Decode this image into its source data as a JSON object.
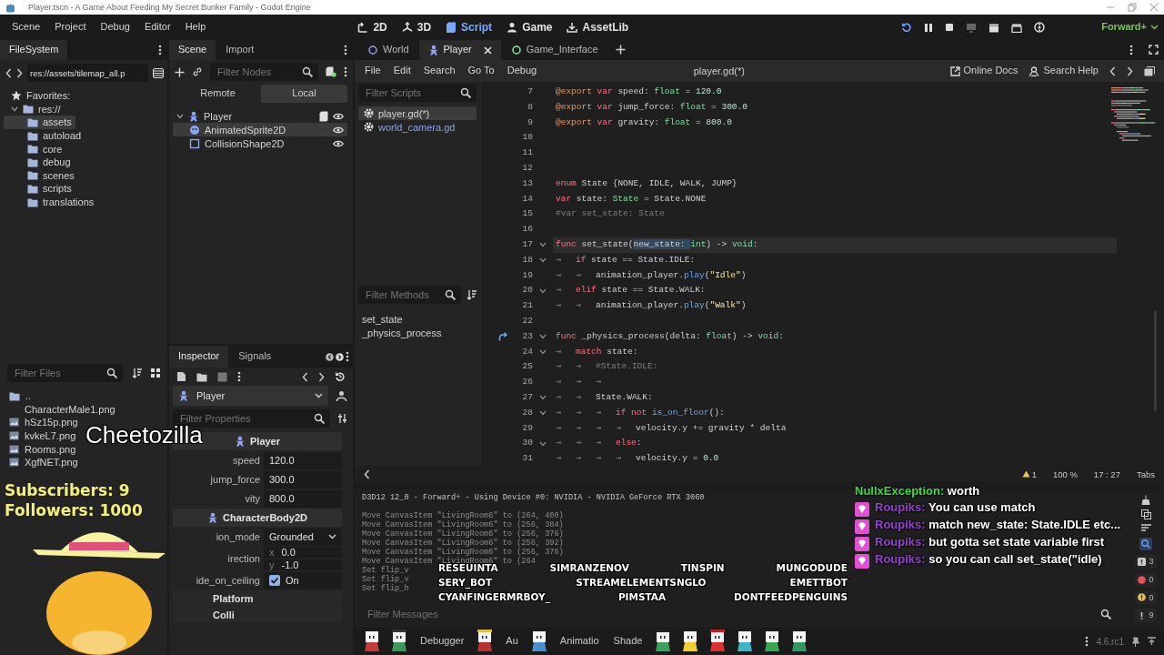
{
  "window": {
    "title": "Player.tscn - A Game About Feeding My Secret Bunker Family - Godot Engine"
  },
  "menu": [
    "Scene",
    "Project",
    "Debug",
    "Editor",
    "Help"
  ],
  "workspaces": [
    {
      "label": "2D",
      "kind": "flat",
      "selected": false
    },
    {
      "label": "3D",
      "kind": "spatial",
      "selected": false
    },
    {
      "label": "Script",
      "kind": "script",
      "selected": true
    },
    {
      "label": "Game",
      "kind": "game",
      "selected": false
    },
    {
      "label": "AssetLib",
      "kind": "assetlib",
      "selected": false
    }
  ],
  "renderer": "Forward+",
  "filesystem": {
    "tab": "FileSystem",
    "path": "res://assets/tilemap_all.p",
    "tree": [
      {
        "label": "Favorites:",
        "kind": "favorites",
        "selected": false
      },
      {
        "label": "res://",
        "kind": "folder",
        "selected": false,
        "expanded": true,
        "children": [
          {
            "label": "assets",
            "kind": "folder",
            "selected": true
          },
          {
            "label": "autoload",
            "kind": "folder",
            "selected": false
          },
          {
            "label": "core",
            "kind": "folder",
            "selected": false
          },
          {
            "label": "debug",
            "kind": "folder",
            "selected": false
          },
          {
            "label": "scenes",
            "kind": "folder",
            "selected": false
          },
          {
            "label": "scripts",
            "kind": "folder",
            "selected": false
          },
          {
            "label": "translations",
            "kind": "folder",
            "selected": false
          }
        ]
      }
    ],
    "filter": {
      "placeholder": "Filter Files"
    },
    "files": [
      {
        "label": "..",
        "kind": "folder"
      },
      {
        "label": "CharacterMale1.png",
        "kind": "blank"
      },
      {
        "label": "hSz15p.png",
        "kind": "image"
      },
      {
        "label": "kvkeL7.png",
        "kind": "image"
      },
      {
        "label": "Rooms.png",
        "kind": "image"
      },
      {
        "label": "XgfNET.png",
        "kind": "image"
      }
    ]
  },
  "scene": {
    "tabs": [
      {
        "label": "Scene",
        "selected": true
      },
      {
        "label": "Import",
        "selected": false
      }
    ],
    "filter": {
      "placeholder": "Filter Nodes"
    },
    "modes": [
      {
        "label": "Remote",
        "selected": false
      },
      {
        "label": "Local",
        "selected": true
      }
    ],
    "tree": [
      {
        "label": "Player",
        "kind": "character",
        "selected": false,
        "expanded": true,
        "script": true,
        "children": [
          {
            "label": "AnimatedSprite2D",
            "kind": "sprite",
            "selected": true,
            "script": false
          },
          {
            "label": "CollisionShape2D",
            "kind": "shape",
            "selected": false,
            "script": false
          }
        ]
      }
    ]
  },
  "inspector": {
    "tabs": [
      {
        "label": "Inspector",
        "selected": true
      },
      {
        "label": "Signals",
        "selected": false
      }
    ],
    "object": "Player",
    "filter": {
      "placeholder": "Filter Properties"
    },
    "rows": [
      {
        "kind": "section",
        "label": "Player"
      },
      {
        "kind": "number",
        "label": "speed",
        "value": "120.0"
      },
      {
        "kind": "number",
        "label": "jump_force",
        "value": "300.0"
      },
      {
        "kind": "number",
        "label": "vity",
        "value": "800.0"
      },
      {
        "kind": "section",
        "label": "CharacterBody2D"
      },
      {
        "kind": "select",
        "label": "ion_mode",
        "value": "Grounded"
      },
      {
        "kind": "vector",
        "label": "irection",
        "axes": [
          {
            "label": "x",
            "value": "0.0"
          },
          {
            "label": "y",
            "value": "-1.0"
          }
        ]
      },
      {
        "kind": "check",
        "label": "ide_on_ceiling",
        "checked": true,
        "value": "On"
      },
      {
        "kind": "group",
        "label": "Platform"
      },
      {
        "kind": "group",
        "label": "Colli"
      }
    ]
  },
  "script_editor": {
    "tabs": [
      {
        "label": "World",
        "kind": "node2d",
        "selected": false
      },
      {
        "label": "Player",
        "kind": "character",
        "selected": true
      },
      {
        "label": "Game_Interface",
        "kind": "control",
        "selected": false
      }
    ],
    "menu": [
      "File",
      "Edit",
      "Search",
      "Go To",
      "Debug"
    ],
    "file": "player.gd(*)",
    "links": [
      "Online Docs",
      "Search Help"
    ],
    "scripts": {
      "placeholder": "Filter Scripts",
      "items": [
        {
          "label": "player.gd(*)",
          "selected": true
        },
        {
          "label": "world_camera.gd",
          "selected": false
        }
      ]
    },
    "methods": {
      "placeholder": "Filter Methods",
      "items": [
        "set_state",
        "_physics_process"
      ]
    },
    "lines": [
      {
        "n": "7",
        "fold": false,
        "current": false,
        "override": false,
        "tokens": [
          {
            "kind": "annotation",
            "text": "@export "
          },
          {
            "kind": "keyword",
            "text": "var"
          },
          {
            "kind": "plain",
            "text": " speed: "
          },
          {
            "kind": "type",
            "text": "float"
          },
          {
            "kind": "plain",
            "text": " = "
          },
          {
            "kind": "number",
            "text": "120.0"
          }
        ]
      },
      {
        "n": "8",
        "fold": false,
        "current": false,
        "override": false,
        "tokens": [
          {
            "kind": "annotation",
            "text": "@export "
          },
          {
            "kind": "keyword",
            "text": "var"
          },
          {
            "kind": "plain",
            "text": " jump_force: "
          },
          {
            "kind": "type",
            "text": "float"
          },
          {
            "kind": "plain",
            "text": " = "
          },
          {
            "kind": "number",
            "text": "300.0"
          }
        ]
      },
      {
        "n": "9",
        "fold": false,
        "current": false,
        "override": false,
        "tokens": [
          {
            "kind": "annotation",
            "text": "@export "
          },
          {
            "kind": "keyword",
            "text": "var"
          },
          {
            "kind": "plain",
            "text": " gravity: "
          },
          {
            "kind": "type",
            "text": "float"
          },
          {
            "kind": "plain",
            "text": " = "
          },
          {
            "kind": "number",
            "text": "800.0"
          }
        ]
      },
      {
        "n": "10",
        "fold": false,
        "current": false,
        "override": false
      },
      {
        "n": "11",
        "fold": false,
        "current": false,
        "override": false
      },
      {
        "n": "12",
        "fold": false,
        "current": false,
        "override": false
      },
      {
        "n": "13",
        "fold": false,
        "current": false,
        "override": false,
        "tokens": [
          {
            "kind": "keyword",
            "text": "enum"
          },
          {
            "kind": "plain",
            "text": " State {NONE, IDLE, WALK, JUMP}"
          }
        ]
      },
      {
        "n": "14",
        "fold": false,
        "current": false,
        "override": false,
        "tokens": [
          {
            "kind": "keyword",
            "text": "var"
          },
          {
            "kind": "plain",
            "text": " state: "
          },
          {
            "kind": "type",
            "text": "State"
          },
          {
            "kind": "plain",
            "text": " = State.NONE"
          }
        ]
      },
      {
        "n": "15",
        "fold": false,
        "current": false,
        "override": false,
        "tokens": [
          {
            "kind": "comment",
            "text": "#var set_state: State"
          }
        ]
      },
      {
        "n": "16",
        "fold": false,
        "current": false,
        "override": false
      },
      {
        "n": "17",
        "fold": true,
        "current": true,
        "override": false,
        "tokens": [
          {
            "kind": "keyword",
            "text": "func"
          },
          {
            "kind": "plain",
            "text": " set_state("
          },
          {
            "kind": "selection",
            "text": "new_state: "
          },
          {
            "kind": "type",
            "text": "int"
          },
          {
            "kind": "plain",
            "text": ") -> "
          },
          {
            "kind": "type",
            "text": "void"
          },
          {
            "kind": "plain",
            "text": ":"
          }
        ]
      },
      {
        "n": "18",
        "fold": true,
        "current": false,
        "override": false,
        "tokens": [
          {
            "kind": "tab",
            "text": "⇥"
          },
          {
            "kind": "keyword",
            "text": "if"
          },
          {
            "kind": "plain",
            "text": " state == State.IDLE:"
          }
        ]
      },
      {
        "n": "19",
        "fold": false,
        "current": false,
        "override": false,
        "tokens": [
          {
            "kind": "tab",
            "text": "⇥"
          },
          {
            "kind": "tab",
            "text": "⇥"
          },
          {
            "kind": "plain",
            "text": "animation_player."
          },
          {
            "kind": "call",
            "text": "play"
          },
          {
            "kind": "plain",
            "text": "("
          },
          {
            "kind": "string",
            "text": "\"Idle\""
          },
          {
            "kind": "plain",
            "text": ")"
          }
        ]
      },
      {
        "n": "20",
        "fold": true,
        "current": false,
        "override": false,
        "tokens": [
          {
            "kind": "tab",
            "text": "⇥"
          },
          {
            "kind": "keyword",
            "text": "elif"
          },
          {
            "kind": "plain",
            "text": " state == State.WALK:"
          }
        ]
      },
      {
        "n": "21",
        "fold": false,
        "current": false,
        "override": false,
        "tokens": [
          {
            "kind": "tab",
            "text": "⇥"
          },
          {
            "kind": "tab",
            "text": "⇥"
          },
          {
            "kind": "plain",
            "text": "animation_player."
          },
          {
            "kind": "call",
            "text": "play"
          },
          {
            "kind": "plain",
            "text": "("
          },
          {
            "kind": "string",
            "text": "\"Walk\""
          },
          {
            "kind": "plain",
            "text": ")"
          }
        ]
      },
      {
        "n": "22",
        "fold": false,
        "current": false,
        "override": false
      },
      {
        "n": "23",
        "fold": true,
        "current": false,
        "override": true,
        "tokens": [
          {
            "kind": "keyword",
            "text": "func"
          },
          {
            "kind": "plain",
            "text": " _physics_process(delta: "
          },
          {
            "kind": "type",
            "text": "float"
          },
          {
            "kind": "plain",
            "text": ") -> "
          },
          {
            "kind": "type",
            "text": "void"
          },
          {
            "kind": "plain",
            "text": ":"
          }
        ]
      },
      {
        "n": "24",
        "fold": true,
        "current": false,
        "override": false,
        "tokens": [
          {
            "kind": "tab",
            "text": "⇥"
          },
          {
            "kind": "keyword",
            "text": "match"
          },
          {
            "kind": "plain",
            "text": " state:"
          }
        ]
      },
      {
        "n": "25",
        "fold": false,
        "current": false,
        "override": false,
        "tokens": [
          {
            "kind": "tab",
            "text": "⇥"
          },
          {
            "kind": "tab",
            "text": "⇥"
          },
          {
            "kind": "comment",
            "text": "#State.IDLE:"
          }
        ]
      },
      {
        "n": "26",
        "fold": false,
        "current": false,
        "override": false,
        "tokens": [
          {
            "kind": "tab",
            "text": "⇥"
          },
          {
            "kind": "tab",
            "text": "⇥"
          },
          {
            "kind": "tab",
            "text": "⇥"
          }
        ]
      },
      {
        "n": "27",
        "fold": true,
        "current": false,
        "override": false,
        "tokens": [
          {
            "kind": "tab",
            "text": "⇥"
          },
          {
            "kind": "tab",
            "text": "⇥"
          },
          {
            "kind": "plain",
            "text": "State.WALK:"
          }
        ]
      },
      {
        "n": "28",
        "fold": true,
        "current": false,
        "override": false,
        "tokens": [
          {
            "kind": "tab",
            "text": "⇥"
          },
          {
            "kind": "tab",
            "text": "⇥"
          },
          {
            "kind": "tab",
            "text": "⇥"
          },
          {
            "kind": "keyword",
            "text": "if "
          },
          {
            "kind": "keyword",
            "text": "not "
          },
          {
            "kind": "call",
            "text": "is_on_floor"
          },
          {
            "kind": "plain",
            "text": "():"
          }
        ]
      },
      {
        "n": "29",
        "fold": false,
        "current": false,
        "override": false,
        "tokens": [
          {
            "kind": "tab",
            "text": "⇥"
          },
          {
            "kind": "tab",
            "text": "⇥"
          },
          {
            "kind": "tab",
            "text": "⇥"
          },
          {
            "kind": "tab",
            "text": "⇥"
          },
          {
            "kind": "plain",
            "text": "velocity.y += gravity * delta"
          }
        ]
      },
      {
        "n": "30",
        "fold": true,
        "current": false,
        "override": false,
        "tokens": [
          {
            "kind": "tab",
            "text": "⇥"
          },
          {
            "kind": "tab",
            "text": "⇥"
          },
          {
            "kind": "tab",
            "text": "⇥"
          },
          {
            "kind": "keyword",
            "text": "else"
          },
          {
            "kind": "plain",
            "text": ":"
          }
        ]
      },
      {
        "n": "31",
        "fold": false,
        "current": false,
        "override": false,
        "tokens": [
          {
            "kind": "tab",
            "text": "⇥"
          },
          {
            "kind": "tab",
            "text": "⇥"
          },
          {
            "kind": "tab",
            "text": "⇥"
          },
          {
            "kind": "tab",
            "text": "⇥"
          },
          {
            "kind": "plain",
            "text": "velocity.y = "
          },
          {
            "kind": "number",
            "text": "0.0"
          }
        ]
      }
    ],
    "status": {
      "warnings": "1",
      "zoom": "100 %",
      "position": "17 :  27",
      "indent": "Tabs"
    }
  },
  "output": {
    "header": "D3D12 12_0 - Forward+ - Using Device #0: NVIDIA - NVIDIA GeForce RTX 3060",
    "lines": [
      "Move CanvasItem \"LivingRoom6\" to (264, 400)",
      "Move CanvasItem \"LivingRoom6\" to (256, 384)",
      "Move CanvasItem \"LivingRoom6\" to (256, 376)",
      "Move CanvasItem \"LivingRoom6\" to (256, 392)",
      "Move CanvasItem \"LivingRoom6\" to (256, 376)",
      "Move CanvasItem \"LivingRoom6\" to (264",
      "Set flip_v",
      "Set flip_v",
      "Set flip_h"
    ],
    "filter": {
      "placeholder": "Filter Messages"
    },
    "counts": [
      {
        "kind": "error",
        "text": "3"
      },
      {
        "kind": "failure",
        "text": "0"
      },
      {
        "kind": "warning",
        "text": "0"
      },
      {
        "kind": "message",
        "text": "9"
      }
    ]
  },
  "bottom_tabs": [
    "Debugger",
    "Au",
    "Animatio",
    "Shade"
  ],
  "version": "4.6.rc1",
  "stream": {
    "title": "Cheetozilla",
    "subscribers": "Subscribers: 9",
    "followers": "Followers: 1000",
    "viewers": [
      [
        "RESEUINTA",
        "SIMRANZENOV",
        "TINSPIN",
        "MUNGODUDE"
      ],
      [
        "SERY_BOT",
        "STREAMELEMENTSNGLO",
        "EMETTBOT"
      ],
      [
        "CYANFINGERMRBOY_",
        "PIMSTAA",
        "DONTFEEDPENGUINS"
      ]
    ],
    "chat": [
      {
        "user": "NullxException:",
        "color": "#35e03a",
        "badge": false,
        "text": "worth"
      },
      {
        "user": "Roupiks:",
        "color": "#9a3fd6",
        "badge": true,
        "text": "You can use match"
      },
      {
        "user": "Roupiks:",
        "color": "#9a3fd6",
        "badge": true,
        "text": "match new_state: State.IDLE etc..."
      },
      {
        "user": "Roupiks:",
        "color": "#9a3fd6",
        "badge": true,
        "text": "but gotta set state variable first"
      },
      {
        "user": "Roupiks:",
        "color": "#9a3fd6",
        "badge": true,
        "text": "so you can call set_state(\"idle)"
      }
    ]
  }
}
